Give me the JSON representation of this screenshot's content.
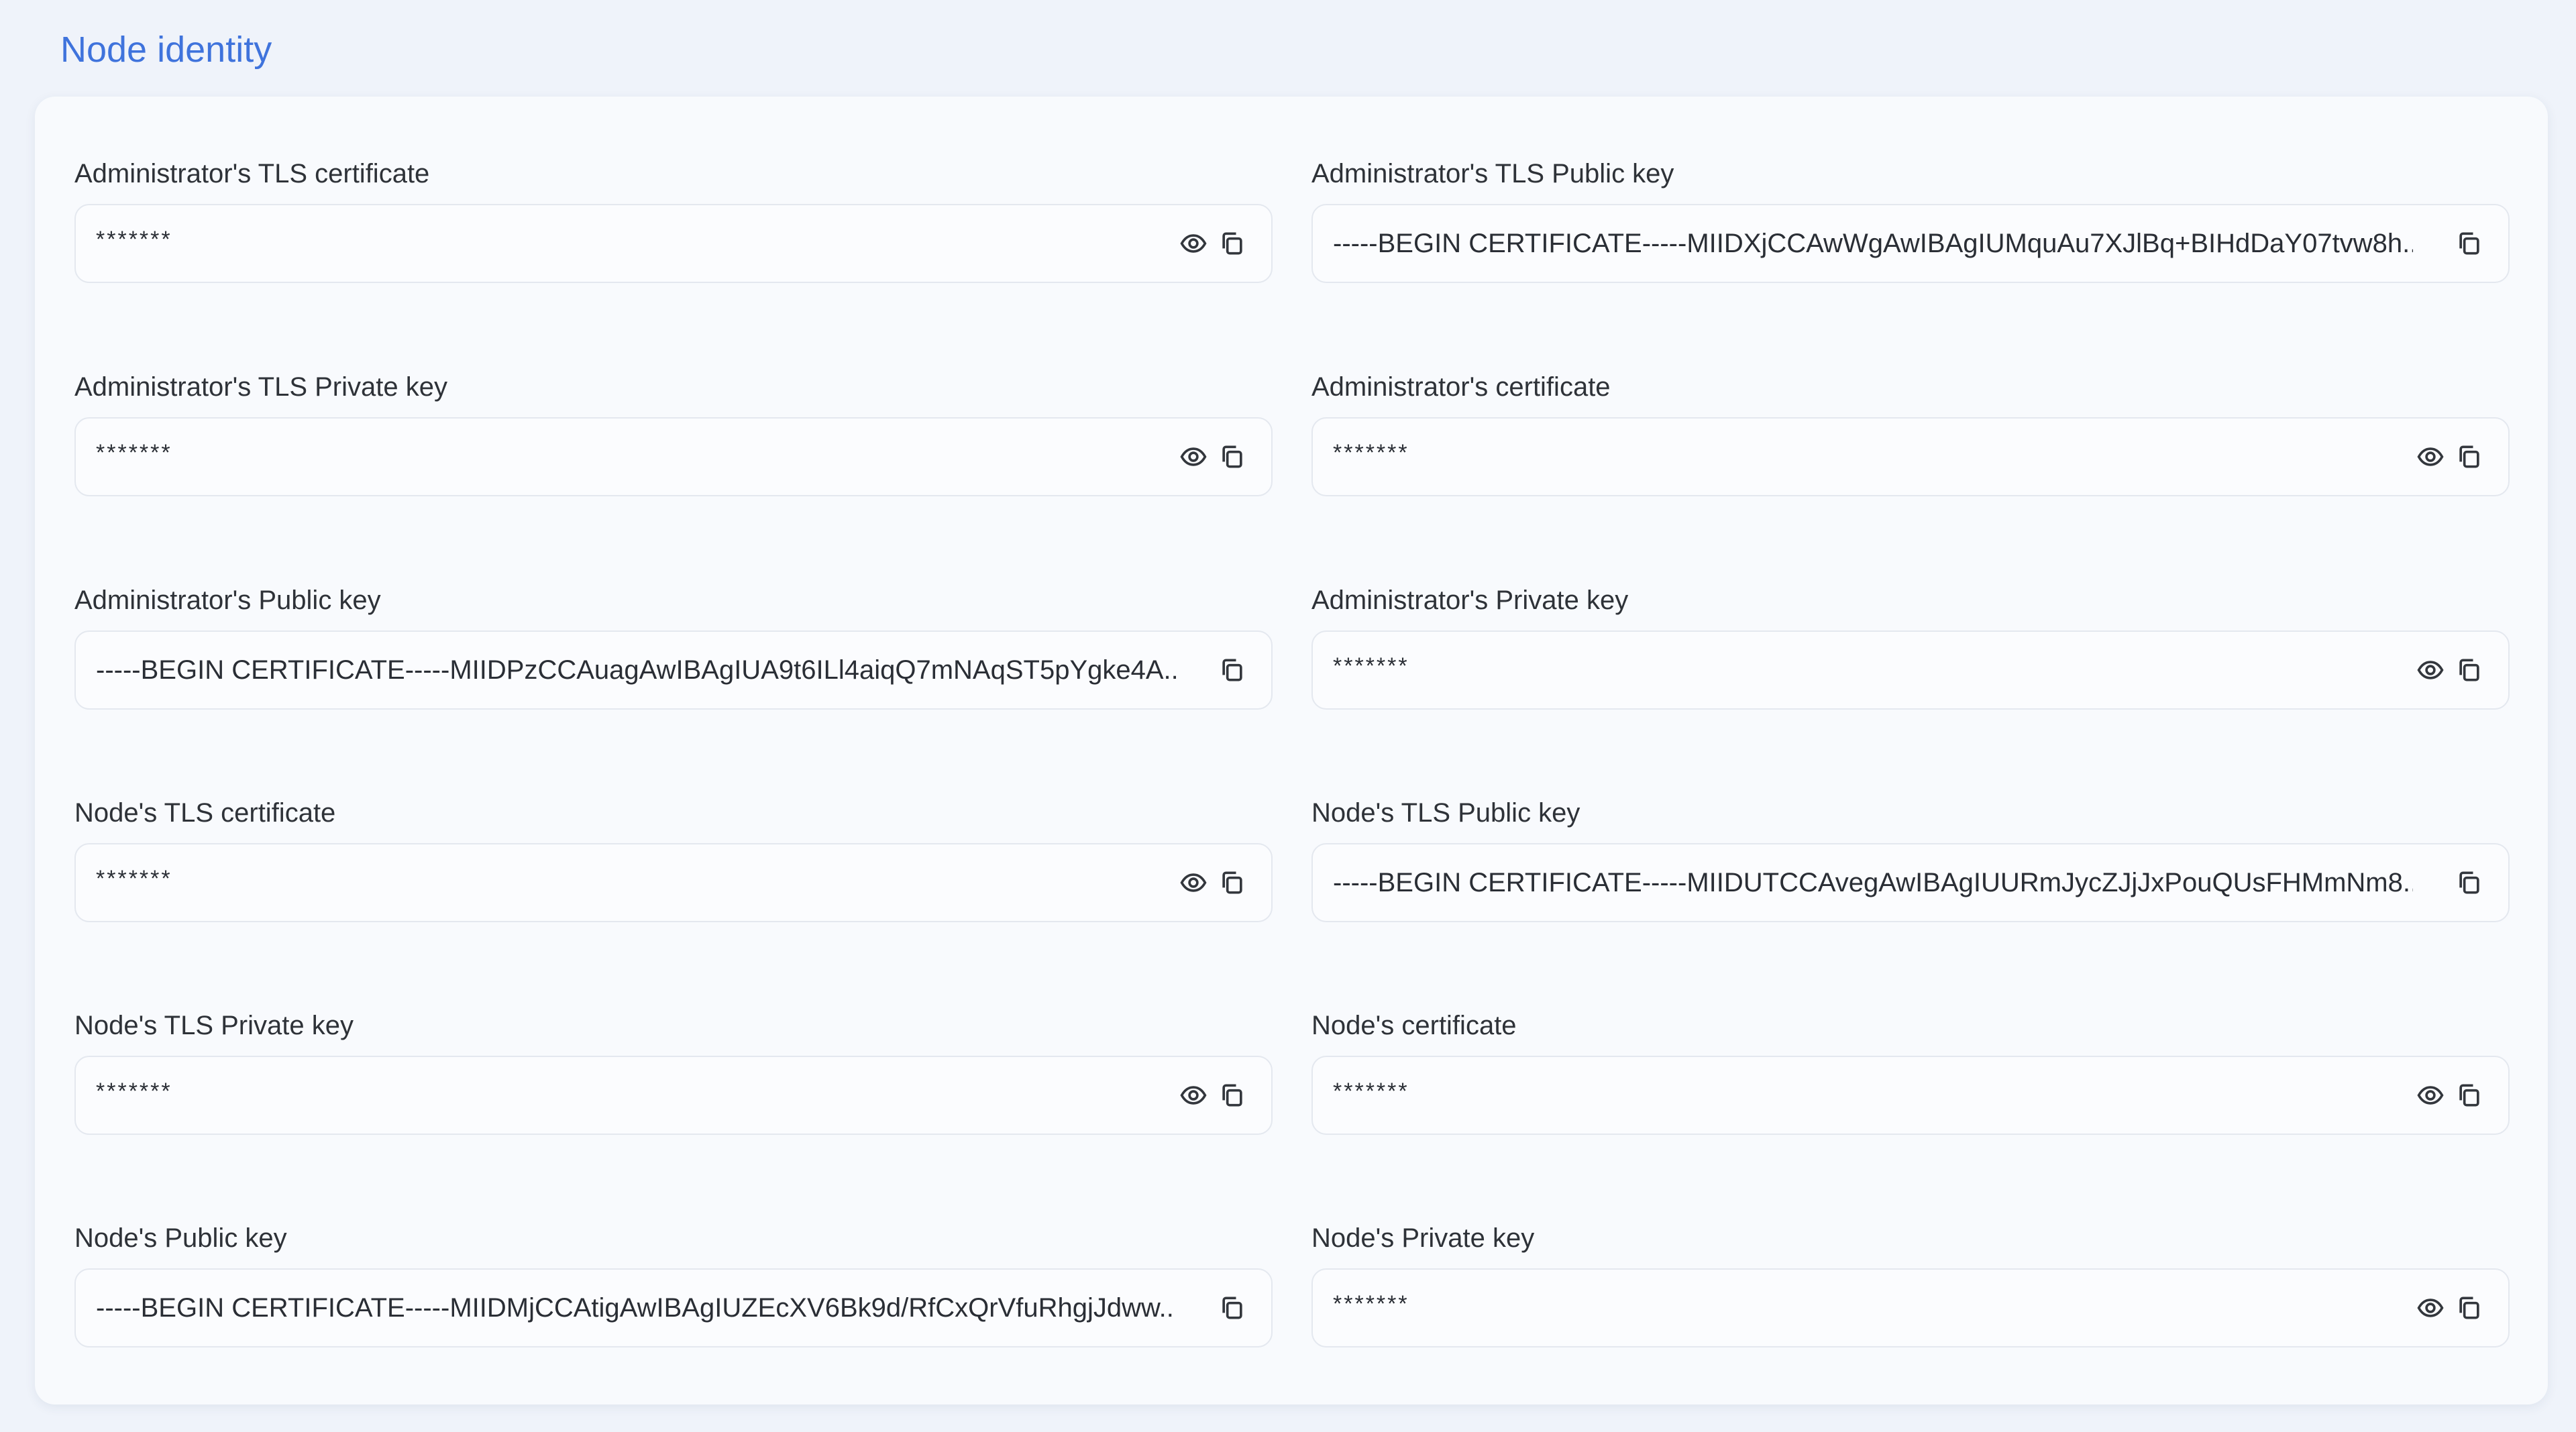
{
  "page": {
    "title": "Node identity"
  },
  "icons": {
    "reveal": "eye-icon",
    "copy": "copy-icon"
  },
  "fields": [
    {
      "label": "Administrator's TLS certificate",
      "value": "*******",
      "masked": true
    },
    {
      "label": "Administrator's TLS Public key",
      "value": "-----BEGIN CERTIFICATE-----MIIDXjCCAwWgAwIBAgIUMquAu7XJlBq+BIHdDaY07tvw8h...",
      "masked": false
    },
    {
      "label": "Administrator's TLS Private key",
      "value": "*******",
      "masked": true
    },
    {
      "label": "Administrator's certificate",
      "value": "*******",
      "masked": true
    },
    {
      "label": "Administrator's Public key",
      "value": "-----BEGIN CERTIFICATE-----MIIDPzCCAuagAwIBAgIUA9t6ILl4aiqQ7mNAqST5pYgke4A...",
      "masked": false
    },
    {
      "label": "Administrator's Private key",
      "value": "*******",
      "masked": true
    },
    {
      "label": "Node's TLS certificate",
      "value": "*******",
      "masked": true
    },
    {
      "label": "Node's TLS Public key",
      "value": "-----BEGIN CERTIFICATE-----MIIDUTCCAvegAwIBAgIUURmJycZJjJxPouQUsFHMmNm8...",
      "masked": false
    },
    {
      "label": "Node's TLS Private key",
      "value": "*******",
      "masked": true
    },
    {
      "label": "Node's certificate",
      "value": "*******",
      "masked": true
    },
    {
      "label": "Node's Public key",
      "value": "-----BEGIN CERTIFICATE-----MIIDMjCCAtigAwIBAgIUZEcXV6Bk9d/RfCxQrVfuRhgjJdww...",
      "masked": false
    },
    {
      "label": "Node's Private key",
      "value": "*******",
      "masked": true
    }
  ]
}
